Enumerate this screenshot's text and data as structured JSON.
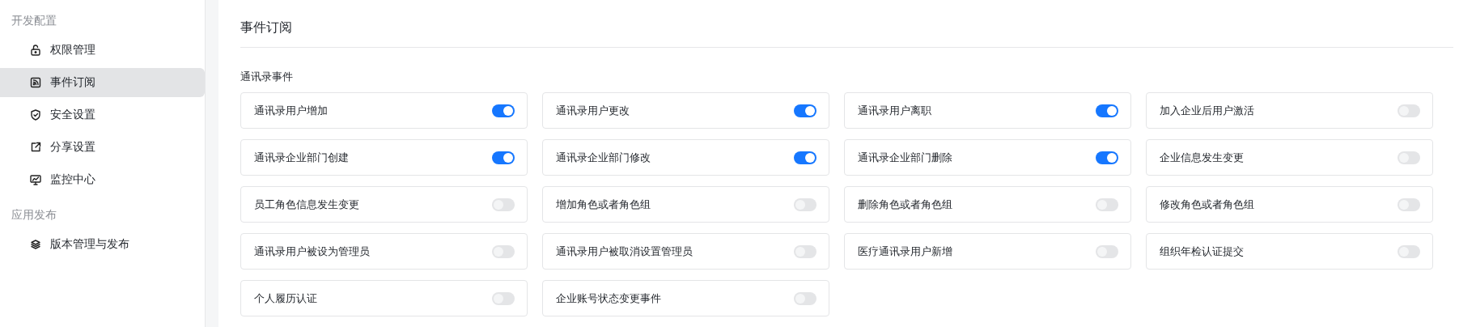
{
  "sidebar": {
    "groups": [
      {
        "title": "开发配置",
        "items": [
          {
            "label": "权限管理",
            "kind": "lock",
            "selected": false
          },
          {
            "label": "事件订阅",
            "kind": "rss",
            "selected": true
          },
          {
            "label": "安全设置",
            "kind": "shield",
            "selected": false
          },
          {
            "label": "分享设置",
            "kind": "share",
            "selected": false
          },
          {
            "label": "监控中心",
            "kind": "monitor",
            "selected": false
          }
        ]
      },
      {
        "title": "应用发布",
        "items": [
          {
            "label": "版本管理与发布",
            "kind": "layers",
            "selected": false
          }
        ]
      }
    ]
  },
  "page": {
    "title": "事件订阅",
    "section": "通讯录事件",
    "events": [
      {
        "label": "通讯录用户增加",
        "on": true
      },
      {
        "label": "通讯录用户更改",
        "on": true
      },
      {
        "label": "通讯录用户离职",
        "on": true
      },
      {
        "label": "加入企业后用户激活",
        "on": false
      },
      {
        "label": "通讯录企业部门创建",
        "on": true
      },
      {
        "label": "通讯录企业部门修改",
        "on": true
      },
      {
        "label": "通讯录企业部门删除",
        "on": true
      },
      {
        "label": "企业信息发生变更",
        "on": false
      },
      {
        "label": "员工角色信息发生变更",
        "on": false
      },
      {
        "label": "增加角色或者角色组",
        "on": false
      },
      {
        "label": "删除角色或者角色组",
        "on": false
      },
      {
        "label": "修改角色或者角色组",
        "on": false
      },
      {
        "label": "通讯录用户被设为管理员",
        "on": false
      },
      {
        "label": "通讯录用户被取消设置管理员",
        "on": false
      },
      {
        "label": "医疗通讯录用户新增",
        "on": false
      },
      {
        "label": "组织年检认证提交",
        "on": false
      },
      {
        "label": "个人履历认证",
        "on": false
      },
      {
        "label": "企业账号状态变更事件",
        "on": false
      }
    ]
  }
}
